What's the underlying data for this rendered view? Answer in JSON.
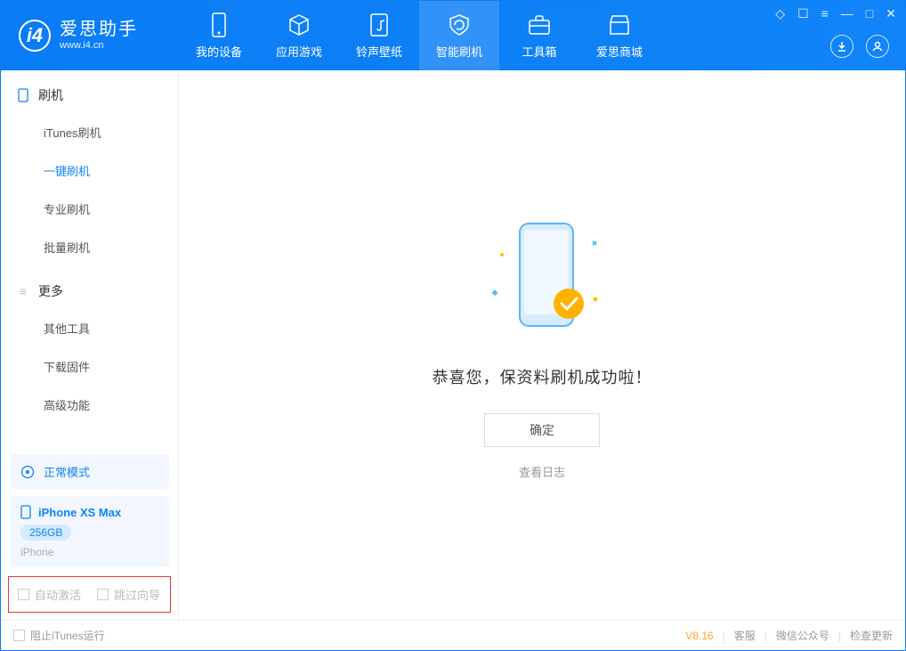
{
  "app": {
    "name": "爱思助手",
    "url": "www.i4.cn"
  },
  "nav": {
    "items": [
      {
        "label": "我的设备"
      },
      {
        "label": "应用游戏"
      },
      {
        "label": "铃声壁纸"
      },
      {
        "label": "智能刷机"
      },
      {
        "label": "工具箱"
      },
      {
        "label": "爱思商城"
      }
    ],
    "activeIndex": 3
  },
  "sidebar": {
    "section1": {
      "title": "刷机",
      "items": [
        {
          "label": "iTunes刷机"
        },
        {
          "label": "一键刷机"
        },
        {
          "label": "专业刷机"
        },
        {
          "label": "批量刷机"
        }
      ],
      "activeIndex": 1
    },
    "section2": {
      "title": "更多",
      "items": [
        {
          "label": "其他工具"
        },
        {
          "label": "下载固件"
        },
        {
          "label": "高级功能"
        }
      ]
    },
    "mode": "正常模式",
    "device": {
      "name": "iPhone XS Max",
      "capacity": "256GB",
      "type": "iPhone"
    },
    "checkboxes": {
      "autoActivate": "自动激活",
      "skipGuide": "跳过向导"
    }
  },
  "main": {
    "successMessage": "恭喜您，保资料刷机成功啦！",
    "okButton": "确定",
    "viewLog": "查看日志"
  },
  "footer": {
    "blockItunes": "阻止iTunes运行",
    "version": "V8.16",
    "links": {
      "support": "客服",
      "wechat": "微信公众号",
      "update": "检查更新"
    }
  }
}
